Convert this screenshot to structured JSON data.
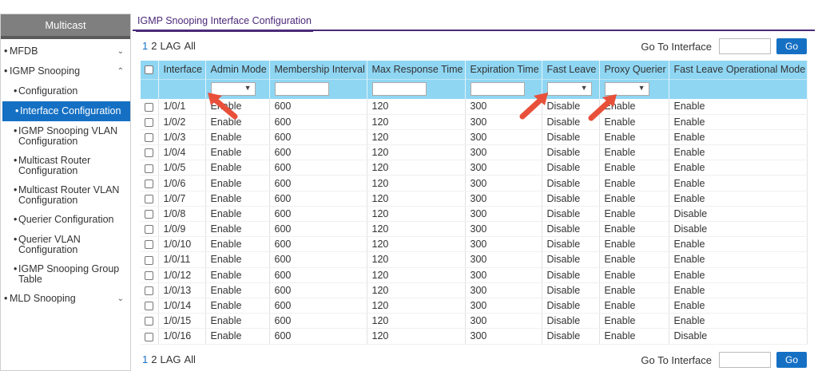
{
  "sidebar": {
    "title": "Multicast",
    "items": [
      {
        "label": "MFDB",
        "chevron": "down"
      },
      {
        "label": "IGMP Snooping",
        "chevron": "up"
      },
      {
        "label": "MLD Snooping",
        "chevron": "down"
      }
    ],
    "igmp_children": [
      {
        "label": "Configuration"
      },
      {
        "label": "Interface Configuration"
      },
      {
        "label": "IGMP Snooping VLAN Configuration"
      },
      {
        "label": "Multicast Router Configuration"
      },
      {
        "label": "Multicast Router VLAN Configuration"
      },
      {
        "label": "Querier Configuration"
      },
      {
        "label": "Querier VLAN Configuration"
      },
      {
        "label": "IGMP Snooping Group Table"
      }
    ]
  },
  "tab": {
    "label": "IGMP Snooping Interface Configuration"
  },
  "pager": {
    "pages": [
      "1",
      "2",
      "LAG",
      "All"
    ],
    "goto_label": "Go To Interface",
    "go_button": "Go"
  },
  "table": {
    "columns": [
      "Interface",
      "Admin Mode",
      "Membership Interval",
      "Max Response Time",
      "Expiration Time",
      "Fast Leave",
      "Proxy Querier",
      "Fast Leave Operational Mode"
    ],
    "rows": [
      [
        "1/0/1",
        "Enable",
        "600",
        "120",
        "300",
        "Disable",
        "Enable",
        "Enable"
      ],
      [
        "1/0/2",
        "Enable",
        "600",
        "120",
        "300",
        "Disable",
        "Enable",
        "Enable"
      ],
      [
        "1/0/3",
        "Enable",
        "600",
        "120",
        "300",
        "Disable",
        "Enable",
        "Enable"
      ],
      [
        "1/0/4",
        "Enable",
        "600",
        "120",
        "300",
        "Disable",
        "Enable",
        "Enable"
      ],
      [
        "1/0/5",
        "Enable",
        "600",
        "120",
        "300",
        "Disable",
        "Enable",
        "Enable"
      ],
      [
        "1/0/6",
        "Enable",
        "600",
        "120",
        "300",
        "Disable",
        "Enable",
        "Enable"
      ],
      [
        "1/0/7",
        "Enable",
        "600",
        "120",
        "300",
        "Disable",
        "Enable",
        "Enable"
      ],
      [
        "1/0/8",
        "Enable",
        "600",
        "120",
        "300",
        "Disable",
        "Enable",
        "Disable"
      ],
      [
        "1/0/9",
        "Enable",
        "600",
        "120",
        "300",
        "Disable",
        "Enable",
        "Disable"
      ],
      [
        "1/0/10",
        "Enable",
        "600",
        "120",
        "300",
        "Disable",
        "Enable",
        "Enable"
      ],
      [
        "1/0/11",
        "Enable",
        "600",
        "120",
        "300",
        "Disable",
        "Enable",
        "Enable"
      ],
      [
        "1/0/12",
        "Enable",
        "600",
        "120",
        "300",
        "Disable",
        "Enable",
        "Enable"
      ],
      [
        "1/0/13",
        "Enable",
        "600",
        "120",
        "300",
        "Disable",
        "Enable",
        "Enable"
      ],
      [
        "1/0/14",
        "Enable",
        "600",
        "120",
        "300",
        "Disable",
        "Enable",
        "Enable"
      ],
      [
        "1/0/15",
        "Enable",
        "600",
        "120",
        "300",
        "Disable",
        "Enable",
        "Enable"
      ],
      [
        "1/0/16",
        "Enable",
        "600",
        "120",
        "300",
        "Disable",
        "Enable",
        "Disable"
      ]
    ]
  },
  "colors": {
    "accent": "#1570c4",
    "header": "#8fd6f3",
    "tab": "#4b2a78",
    "annotation_arrow": "#e8503a"
  }
}
